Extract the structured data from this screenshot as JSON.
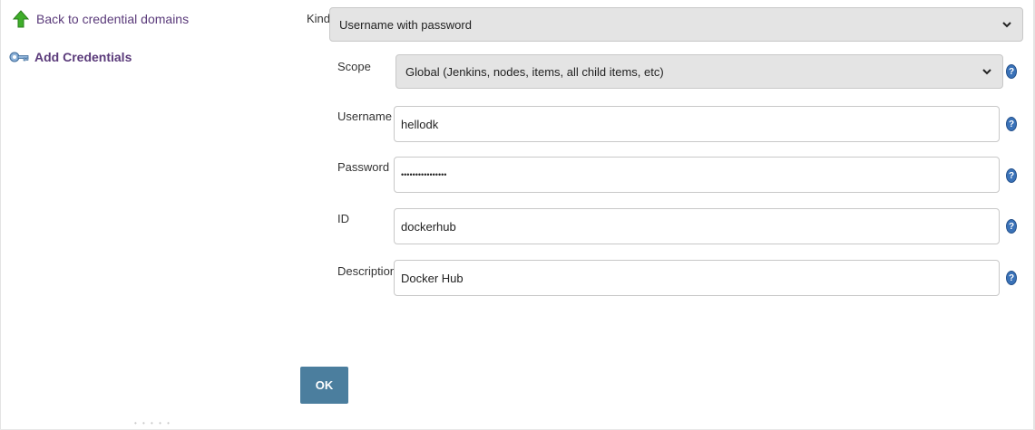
{
  "sidebar": {
    "back_label": "Back to credential domains",
    "add_label": "Add Credentials",
    "back_icon": "up-arrow-icon",
    "add_icon": "key-icon",
    "link_color": "#5a3a7a",
    "resize_handle": "• • • • •"
  },
  "form": {
    "kind": {
      "label": "Kind",
      "value": "Username with password"
    },
    "scope": {
      "label": "Scope",
      "value": "Global (Jenkins, nodes, items, all child items, etc)"
    },
    "username": {
      "label": "Username",
      "value": "hellodk"
    },
    "password": {
      "label": "Password",
      "value": "••••••••••••••••"
    },
    "id": {
      "label": "ID",
      "value": "dockerhub"
    },
    "description": {
      "label": "Description",
      "value": "Docker Hub"
    },
    "help_glyph": "?",
    "submit_label": "OK",
    "submit_color": "#4b7e9e",
    "help_color": "#3a72b8"
  }
}
